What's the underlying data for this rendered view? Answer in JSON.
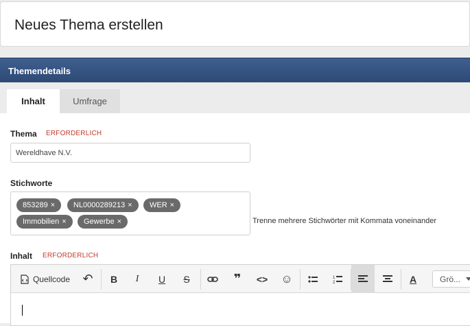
{
  "page": {
    "title": "Neues Thema erstellen"
  },
  "panel": {
    "header": "Themendetails"
  },
  "tabs": [
    {
      "label": "Inhalt",
      "active": true
    },
    {
      "label": "Umfrage",
      "active": false
    }
  ],
  "form": {
    "thema": {
      "label": "Thema",
      "required": "ERFORDERLICH",
      "value": "Wereldhave N.V."
    },
    "stichworte": {
      "label": "Stichworte",
      "tags": [
        "853289",
        "NL0000289213",
        "WER",
        "Immobilien",
        "Gewerbe"
      ],
      "remove_glyph": "×",
      "hint": "Trenne mehrere Stichwörter mit Kommata voneinander"
    },
    "inhalt": {
      "label": "Inhalt",
      "required": "ERFORDERLICH"
    }
  },
  "editor": {
    "toolbar": {
      "source_label": "Quellcode",
      "undo": "↶",
      "bold": "B",
      "italic": "I",
      "underline": "U",
      "strike": "S",
      "link": "⛓",
      "quote": "❞",
      "code": "<>",
      "emoji": "☺",
      "bulleted_list": "☰",
      "numbered_list": "☷",
      "align_left": "≡",
      "align_center": "≡",
      "text_color": "A",
      "font_size_label": "Grö..."
    }
  },
  "colors": {
    "header_bg": "#2e4a76",
    "required": "#c0392b",
    "tag_bg": "#6a6a6a"
  }
}
